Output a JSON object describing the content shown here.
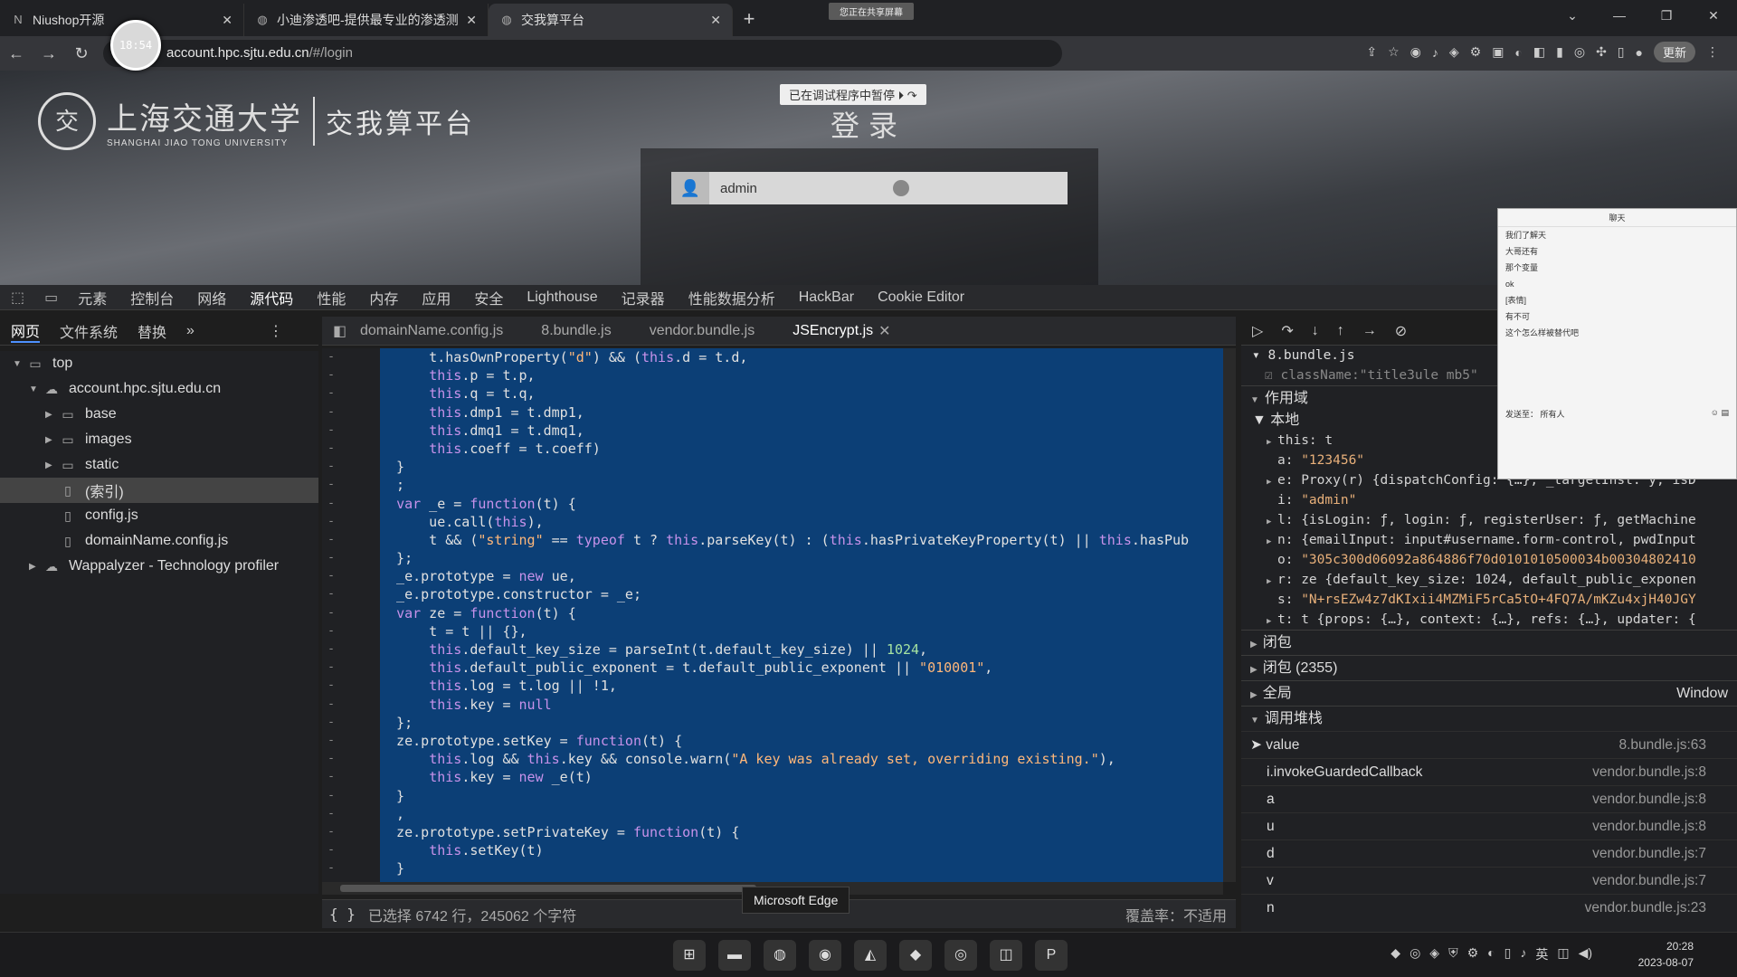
{
  "browser": {
    "tabs": [
      {
        "title": "Niushop开源",
        "icon": "N"
      },
      {
        "title": "小迪渗透吧-提供最专业的渗透测",
        "icon": "globe"
      },
      {
        "title": "交我算平台",
        "icon": "globe",
        "active": true
      }
    ],
    "share_note": "您正在共享屏幕",
    "recording_clock": "18:54",
    "url_prefix": "account.hpc.sjtu.edu.cn",
    "url_suffix": "/#/login",
    "update_label": "更新"
  },
  "page": {
    "seal_glyph": "交",
    "univ_cn": "上海交通大学",
    "univ_en": "SHANGHAI JIAO TONG UNIVERSITY",
    "platform": "交我算平台",
    "paused_banner": "已在调试程序中暂停",
    "login_title": "登录",
    "username_value": "admin"
  },
  "chat": {
    "title": "聊天",
    "messages": [
      "我们了解天",
      "大哥还有",
      "那个变量",
      "ok",
      "[表情]",
      "有不可",
      "这个怎么样被替代吧"
    ],
    "send_label": "发送至：",
    "send_target": "所有人"
  },
  "devtools": {
    "tabs": [
      "元素",
      "控制台",
      "网络",
      "源代码",
      "性能",
      "内存",
      "应用",
      "安全",
      "Lighthouse",
      "记录器",
      "性能数据分析",
      "HackBar",
      "Cookie Editor"
    ],
    "nav_tabs": [
      "网页",
      "文件系统",
      "替换"
    ],
    "tree": [
      {
        "label": "top",
        "level": 0,
        "icon": "frame"
      },
      {
        "label": "account.hpc.sjtu.edu.cn",
        "level": 1,
        "icon": "cloud"
      },
      {
        "label": "base",
        "level": 2,
        "icon": "folder"
      },
      {
        "label": "images",
        "level": 2,
        "icon": "folder"
      },
      {
        "label": "static",
        "level": 2,
        "icon": "folder"
      },
      {
        "label": "(索引)",
        "level": 2,
        "icon": "file",
        "selected": true
      },
      {
        "label": "config.js",
        "level": 2,
        "icon": "file"
      },
      {
        "label": "domainName.config.js",
        "level": 2,
        "icon": "file"
      },
      {
        "label": "Wappalyzer - Technology profiler",
        "level": 1,
        "icon": "cloud"
      }
    ],
    "editor_tabs": [
      "domainName.config.js",
      "8.bundle.js",
      "vendor.bundle.js",
      "JSEncrypt.js"
    ],
    "code_lines": [
      "    t.hasOwnProperty(\"d\") && (this.d = t.d,",
      "    this.p = t.p,",
      "    this.q = t.q,",
      "    this.dmp1 = t.dmp1,",
      "    this.dmq1 = t.dmq1,",
      "    this.coeff = t.coeff)",
      "}",
      ";",
      "var _e = function(t) {",
      "    ue.call(this),",
      "    t && (\"string\" == typeof t ? this.parseKey(t) : (this.hasPrivateKeyProperty(t) || this.hasPub",
      "};",
      "_e.prototype = new ue,",
      "_e.prototype.constructor = _e;",
      "var ze = function(t) {",
      "    t = t || {},",
      "    this.default_key_size = parseInt(t.default_key_size) || 1024,",
      "    this.default_public_exponent = t.default_public_exponent || \"010001\",",
      "    this.log = t.log || !1,",
      "    this.key = null",
      "};",
      "ze.prototype.setKey = function(t) {",
      "    this.log && this.key && console.warn(\"A key was already set, overriding existing.\"),",
      "    this.key = new _e(t)",
      "}",
      ",",
      "ze.prototype.setPrivateKey = function(t) {",
      "    this.setKey(t)",
      "}"
    ],
    "status_text": "已选择 6742 行，245062 个字符",
    "coverage": "覆盖率：不适用",
    "edge_tooltip": "Microsoft Edge",
    "debugger": {
      "breakpoint_file": "8.bundle.js",
      "breakpoint_code": "className:\"title3ule mb5\"",
      "scope_label": "作用域",
      "local_label": "本地",
      "scope_rows": [
        {
          "key": "this",
          "val": "t"
        },
        {
          "key": "a",
          "val": "\"123456\""
        },
        {
          "key": "e",
          "val": "Proxy(r) {dispatchConfig: {…}, _targetInst: y, isD"
        },
        {
          "key": "i",
          "val": "\"admin\""
        },
        {
          "key": "l",
          "val": "{isLogin: ƒ, login: ƒ, registerUser: ƒ, getMachine"
        },
        {
          "key": "n",
          "val": "{emailInput: input#username.form-control, pwdInput"
        },
        {
          "key": "o",
          "val": "\"305c300d06092a864886f70d0101010500034b00304802410"
        },
        {
          "key": "r",
          "val": "ze {default_key_size: 1024, default_public_exponen"
        },
        {
          "key": "s",
          "val": "\"N+rsEZw4z7dKIxii4MZMiF5rCa5tO+4FQ7A/mKZu4xjH40JGY"
        },
        {
          "key": "t",
          "val": "t {props: {…}, context: {…}, refs: {…}, updater: {"
        }
      ],
      "closure1": "闭包",
      "closure2": "闭包 (2355)",
      "global": "全局",
      "global_val": "Window",
      "callstack_label": "调用堆栈",
      "callstack": [
        {
          "fn": "value",
          "loc": "8.bundle.js:63"
        },
        {
          "fn": "i.invokeGuardedCallback",
          "loc": "vendor.bundle.js:8"
        },
        {
          "fn": "a",
          "loc": "vendor.bundle.js:8"
        },
        {
          "fn": "u",
          "loc": "vendor.bundle.js:8"
        },
        {
          "fn": "d",
          "loc": "vendor.bundle.js:7"
        },
        {
          "fn": "v",
          "loc": "vendor.bundle.js:7"
        },
        {
          "fn": "n",
          "loc": "vendor.bundle.js:23"
        }
      ]
    }
  },
  "taskbar": {
    "time": "20:28",
    "date": "2023-08-07",
    "ime": "英"
  }
}
